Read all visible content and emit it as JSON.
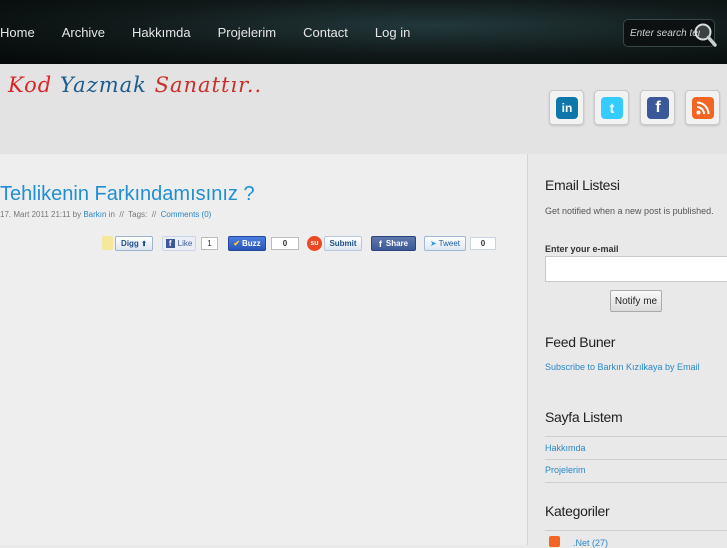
{
  "nav": {
    "items": [
      "Home",
      "Archive",
      "Hakkımda",
      "Projelerim",
      "Contact",
      "Log in"
    ],
    "search_placeholder": "Enter search term"
  },
  "header": {
    "logo_words": [
      "Kod",
      "Yazmak",
      "Sanattır.."
    ],
    "social": [
      {
        "icon": "linkedin-icon",
        "glyph": "in",
        "color": "#0e76a8"
      },
      {
        "icon": "twitter-icon",
        "glyph": "t",
        "color": "#33ccff"
      },
      {
        "icon": "facebook-icon",
        "glyph": "f",
        "color": "#3b5998"
      },
      {
        "icon": "rss-icon",
        "glyph": "",
        "color": "#f26522"
      }
    ]
  },
  "post": {
    "title": "Tehlikenin Farkındamısınız ?",
    "date": "17. Mart 2011 21:11 by",
    "author": "Barkın",
    "in_label": "in",
    "tags_label": "Tags:",
    "sep": "//",
    "comments": "Comments (0)"
  },
  "share": {
    "digg": "Digg",
    "like": "Like",
    "like_count": "1",
    "buzz": "Buzz",
    "buzz_count": "0",
    "submit": "Submit",
    "fb_share": "Share",
    "tweet": "Tweet",
    "tweet_count": "0"
  },
  "sidebar": {
    "email_title": "Email Listesi",
    "email_desc": "Get notified when a new post is published.",
    "email_label": "Enter your e-mail",
    "notify": "Notify me",
    "feed_title": "Feed Buner",
    "feed_link": "Subscribe to Barkın Kızılkaya by Email",
    "pages_title": "Sayfa Listem",
    "pages": [
      "Hakkımda",
      "Projelerim"
    ],
    "cat_title": "Kategoriler",
    "cat_first": ".Net (27)"
  }
}
